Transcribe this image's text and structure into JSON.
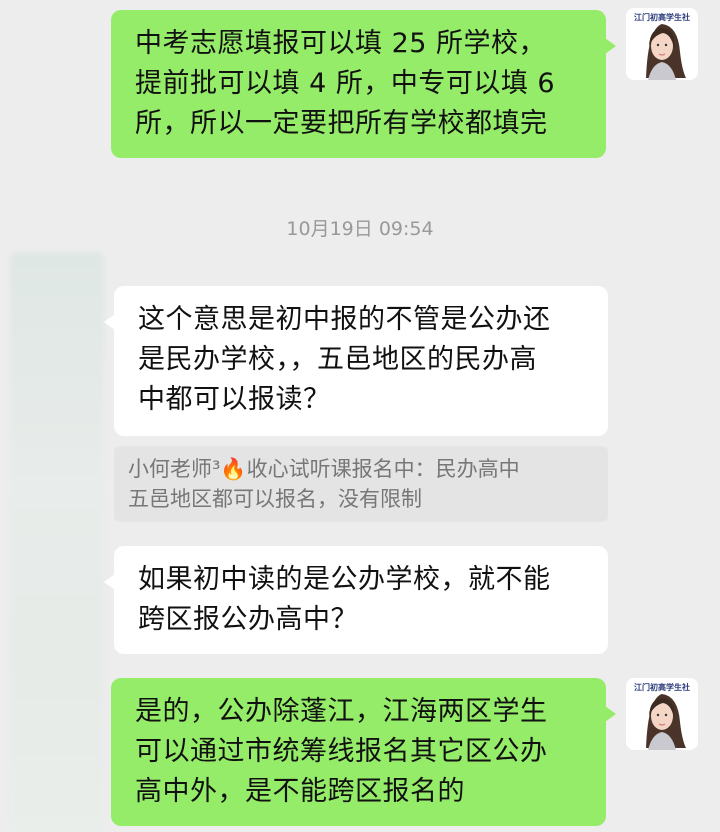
{
  "chat": {
    "avatar_label": "江门初高学生社",
    "messages": [
      {
        "lines": [
          "中考志愿填报可以填 25 所学校，",
          "提前批可以填 4 所，中专可以填 6",
          "所，所以一定要把所有学校都填完"
        ]
      },
      {
        "lines": [
          "这个意思是初中报的不管是公办还",
          "是民办学校，，五邑地区的民办高",
          "中都可以报读？"
        ]
      },
      {
        "lines": [
          "如果初中读的是公办学校，就不能",
          "跨区报公办高中？"
        ]
      },
      {
        "lines": [
          "是的，公办除蓬江，江海两区学生",
          "可以通过市统筹线报名其它区公办",
          "高中外，是不能跨区报名的"
        ]
      }
    ],
    "timestamp": "10月19日 09:54",
    "quote": {
      "lines": [
        "小何老师³🔥收心试听课报名中：民办高中",
        "五邑地区都可以报名，没有限制"
      ]
    }
  }
}
